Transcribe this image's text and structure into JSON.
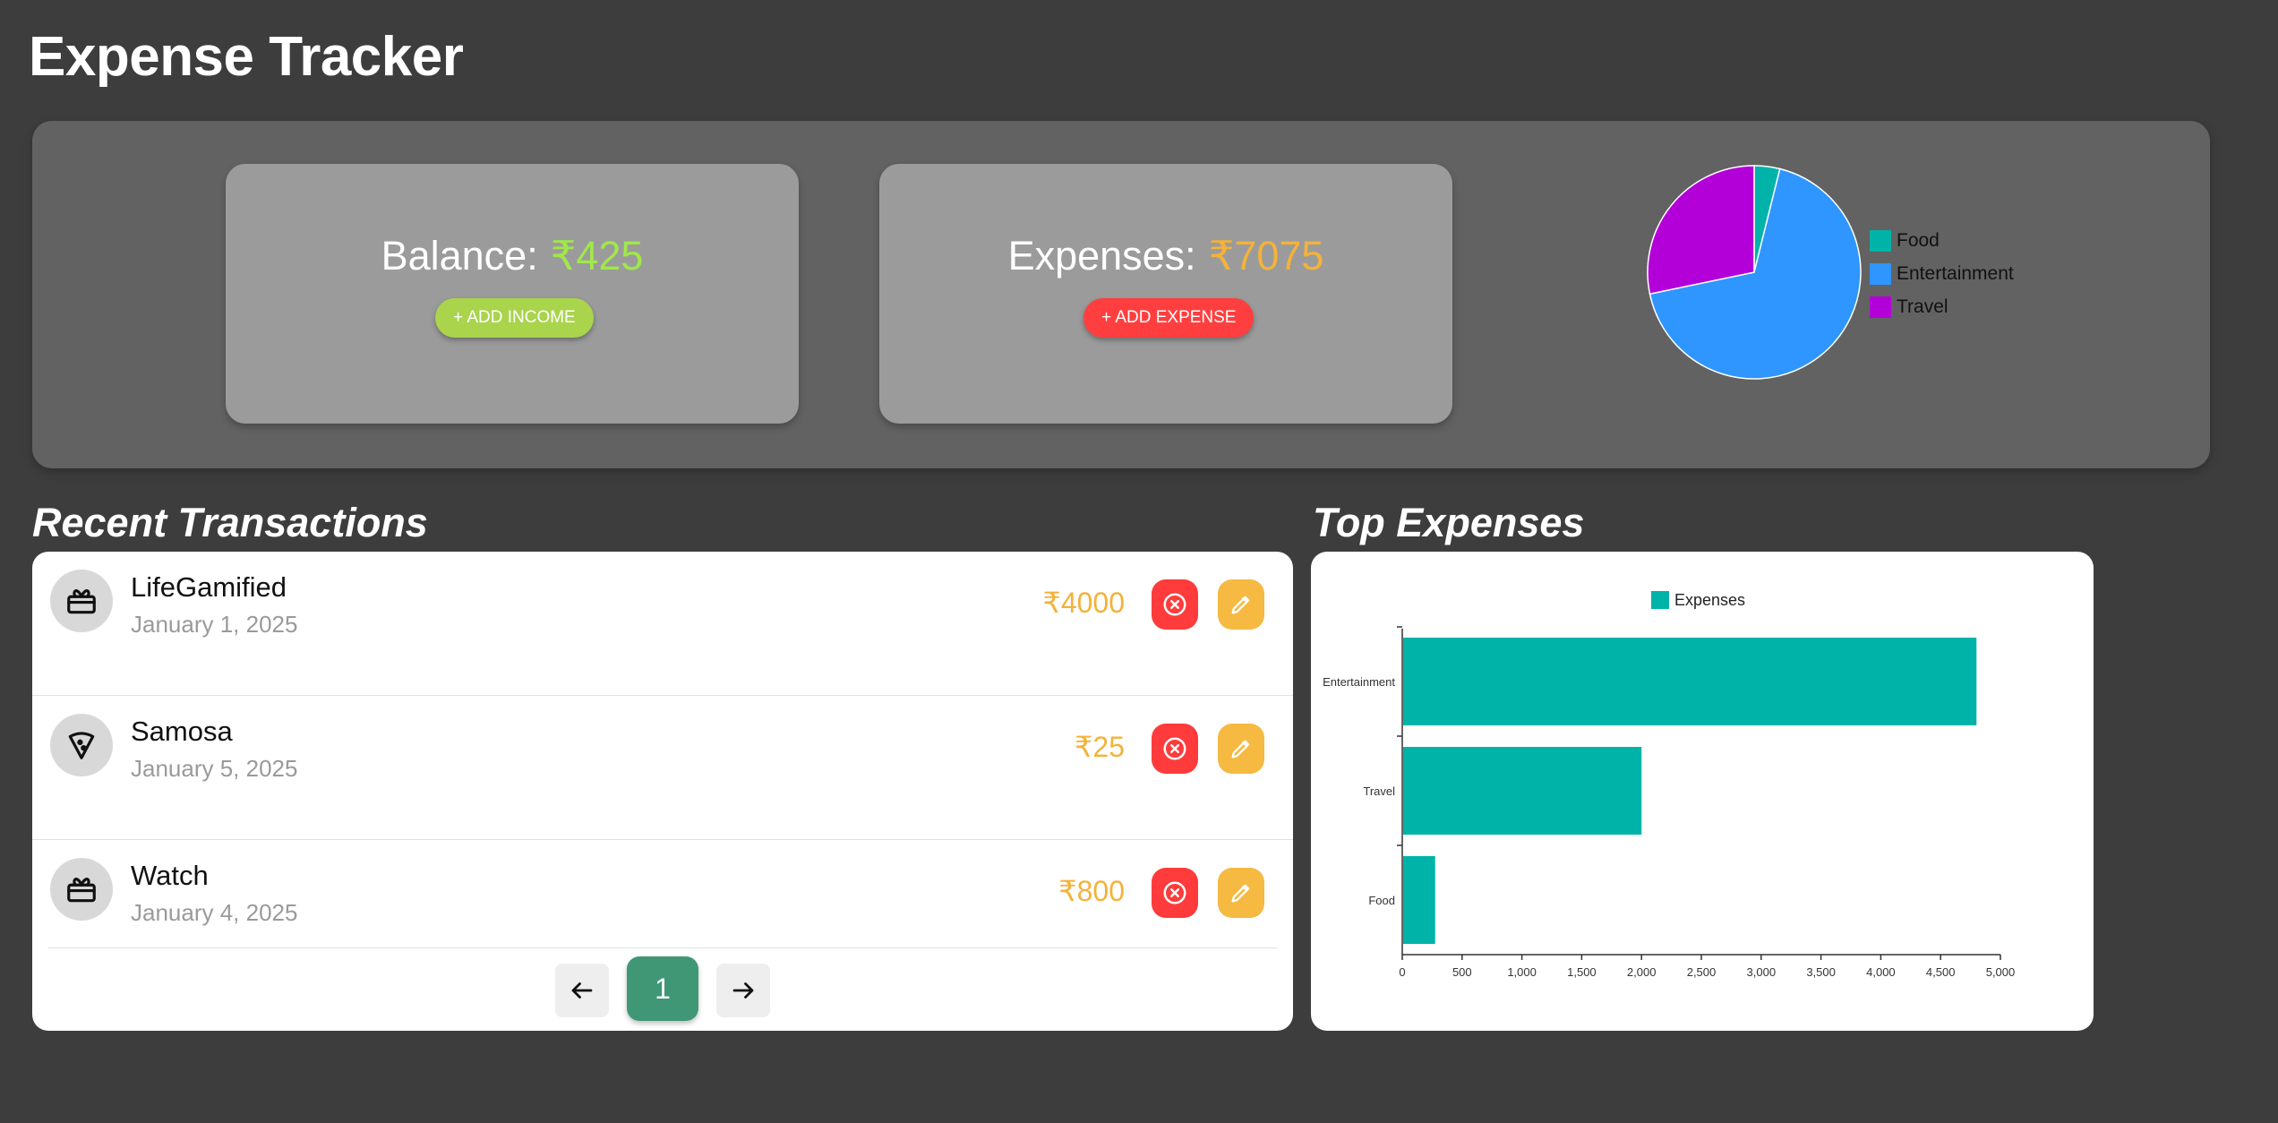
{
  "app": {
    "title": "Expense Tracker"
  },
  "summary": {
    "balance": {
      "label": "Balance:",
      "amount": "₹425",
      "amount_color": "#a0e84a",
      "button_label": "+ ADD INCOME",
      "button_color": "#a9d44c"
    },
    "expenses": {
      "label": "Expenses:",
      "amount": "₹7075",
      "amount_color": "#f3b23a",
      "button_label": "+ ADD EXPENSE",
      "button_color": "#ff3f3f"
    },
    "pie_legend": [
      {
        "label": "Food",
        "color": "#00b3a8"
      },
      {
        "label": "Entertainment",
        "color": "#2f95ff"
      },
      {
        "label": "Travel",
        "color": "#b400d8"
      }
    ]
  },
  "pie_chart_data": {
    "type": "pie",
    "categories": [
      "Food",
      "Entertainment",
      "Travel"
    ],
    "values": [
      275,
      4800,
      2000
    ],
    "colors": [
      "#00b3a8",
      "#2f95ff",
      "#b400d8"
    ]
  },
  "recent": {
    "title": "Recent Transactions",
    "transactions": [
      {
        "name": "LifeGamified",
        "date": "January 1, 2025",
        "amount": "₹4000",
        "icon": "gift-icon"
      },
      {
        "name": "Samosa",
        "date": "January 5, 2025",
        "amount": "₹25",
        "icon": "pizza-icon"
      },
      {
        "name": "Watch",
        "date": "January 4, 2025",
        "amount": "₹800",
        "icon": "gift-icon"
      }
    ],
    "pagination": {
      "current_page": "1",
      "prev_icon": "arrow-left-icon",
      "next_icon": "arrow-right-icon"
    }
  },
  "top_expenses": {
    "title": "Top Expenses"
  },
  "chart_data": {
    "type": "bar",
    "orientation": "horizontal",
    "categories": [
      "Entertainment",
      "Travel",
      "Food"
    ],
    "series": [
      {
        "name": "Expenses",
        "values": [
          4800,
          2000,
          275
        ],
        "color": "#00b3a8"
      }
    ],
    "xlim": [
      0,
      5000
    ],
    "x_ticks": [
      "0",
      "500",
      "1,000",
      "1,500",
      "2,000",
      "2,500",
      "3,000",
      "3,500",
      "4,000",
      "4,500",
      "5,000"
    ],
    "legend_position": "top-center",
    "grid": false
  }
}
